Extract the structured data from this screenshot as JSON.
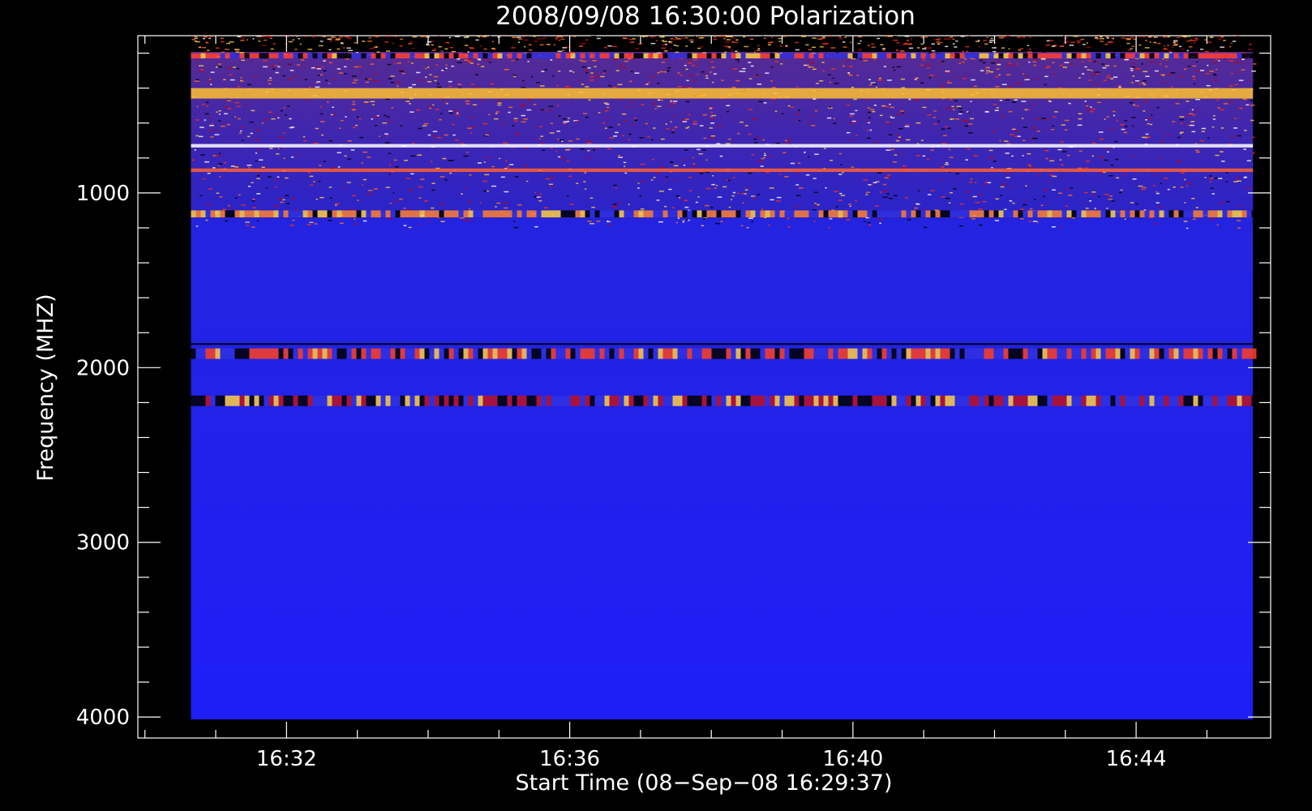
{
  "chart_data": {
    "type": "heatmap",
    "title": "2008/09/08 16:30:00 Polarization",
    "xlabel": "Start Time (08−Sep−08 16:29:37)",
    "ylabel": "Frequency (MHZ)",
    "x_ticks": [
      "16:32",
      "16:36",
      "16:40",
      "16:44"
    ],
    "x_tick_values_min": [
      2,
      6,
      10,
      14
    ],
    "y_ticks": [
      1000,
      2000,
      3000,
      4000
    ],
    "xlim_min": [
      -0.1,
      15.9
    ],
    "ylim_mhz": [
      100,
      4120
    ],
    "y_inverted": true,
    "data_x_range_min": [
      0.65,
      15.65
    ],
    "data_y_range_mhz": [
      1,
      4000
    ],
    "colorscale": [
      "#000000",
      "#1010ff",
      "#2828f0",
      "#c00010",
      "#ff3010",
      "#ffd040",
      "#ffffff"
    ],
    "background_color": "#1e1ef5",
    "bands": [
      {
        "freq_mhz": [
          200,
          230
        ],
        "intensity": "mixed",
        "description_color": "#ff4030"
      },
      {
        "freq_mhz": [
          400,
          460
        ],
        "intensity": "high",
        "description_color": "#ffc030"
      },
      {
        "freq_mhz": [
          720,
          740
        ],
        "intensity": "high",
        "description_color": "#ffffff"
      },
      {
        "freq_mhz": [
          860,
          880
        ],
        "intensity": "medium",
        "description_color": "#ff6030"
      },
      {
        "freq_mhz": [
          1100,
          1140
        ],
        "intensity": "mixed",
        "description_color": "#ff8030"
      },
      {
        "freq_mhz": [
          1860,
          1870
        ],
        "intensity": "low",
        "description_color": "#000000"
      },
      {
        "freq_mhz": [
          1890,
          1950
        ],
        "intensity": "mixed",
        "description_color": "#ff4020"
      },
      {
        "freq_mhz": [
          2160,
          2220
        ],
        "intensity": "mixed",
        "description_color": "#c01020"
      }
    ]
  }
}
